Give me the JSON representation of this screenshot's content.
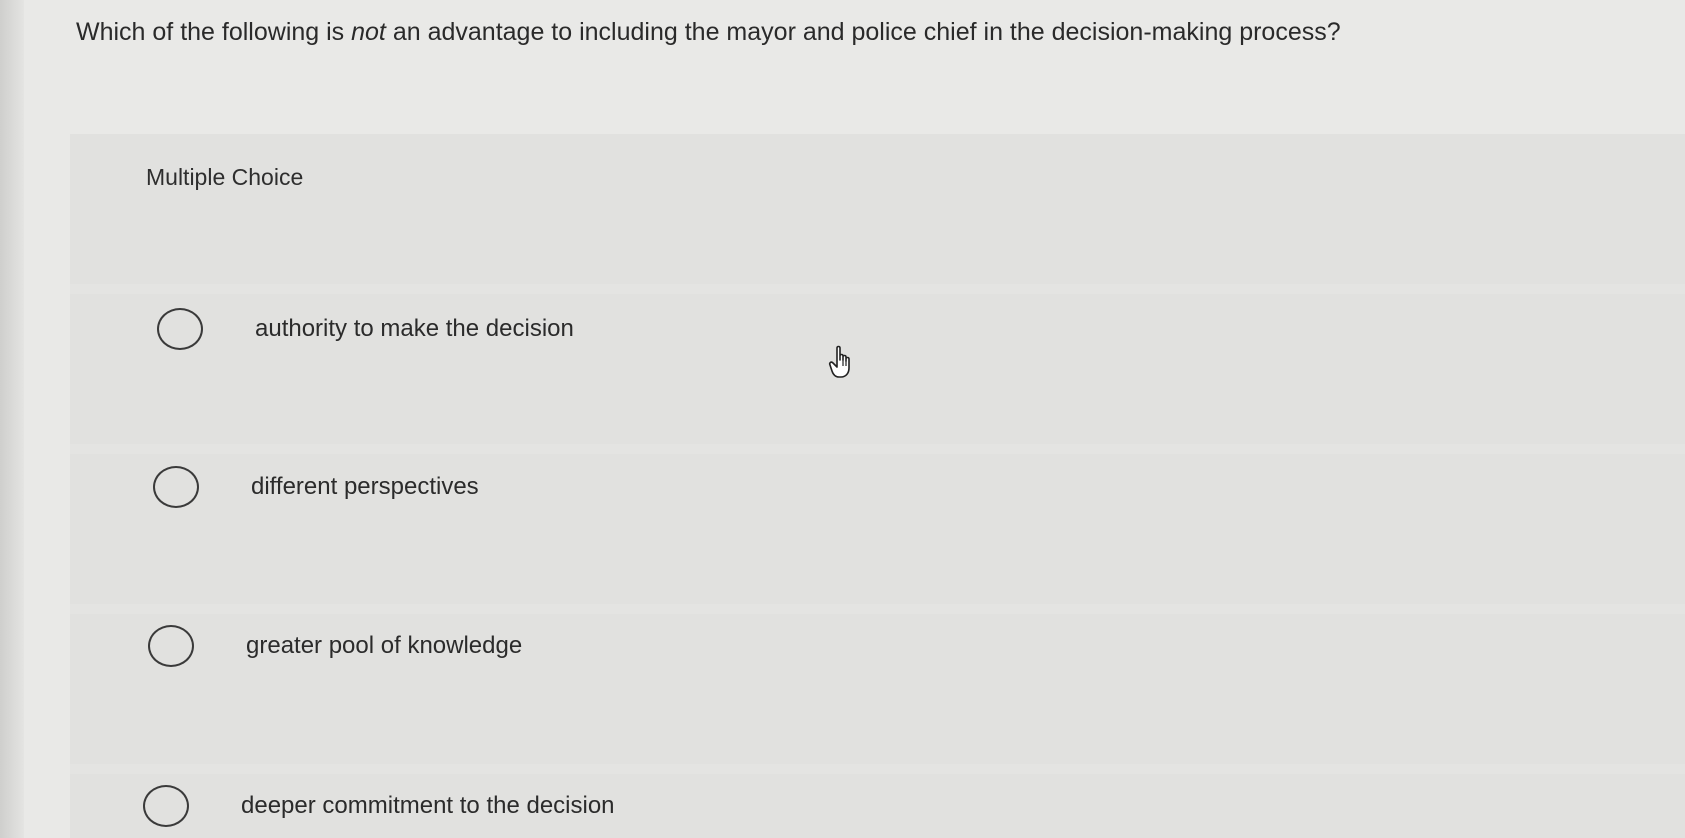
{
  "question": {
    "prefix": "Which of the following is ",
    "emphasis": "not",
    "suffix": " an advantage to including the mayor and police chief in the decision-making process?"
  },
  "panel": {
    "label": "Multiple Choice"
  },
  "options": [
    {
      "label": "authority to make the decision",
      "selected": false
    },
    {
      "label": "different perspectives",
      "selected": false
    },
    {
      "label": "greater pool of knowledge",
      "selected": false
    },
    {
      "label": "deeper commitment to the decision",
      "selected": false
    }
  ],
  "icons": {
    "cursor": "hand-pointer-icon",
    "radio": "radio-circle-icon"
  }
}
